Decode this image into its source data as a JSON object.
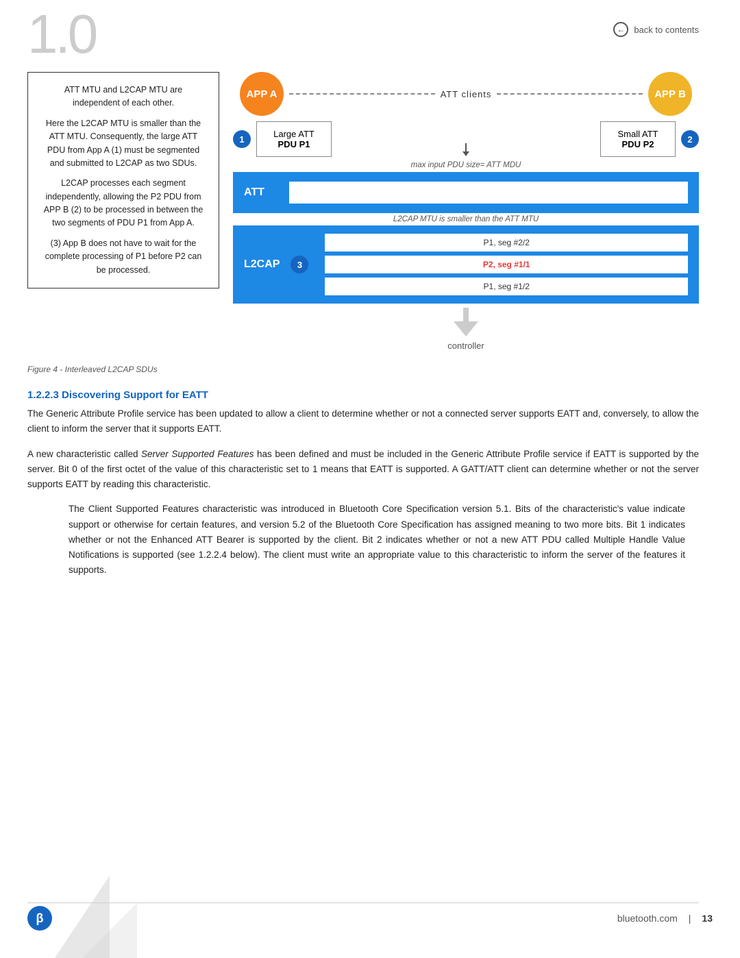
{
  "watermark": "1.0",
  "back_to_contents": "back to contents",
  "textbox": {
    "para1": "ATT MTU and L2CAP MTU are independent of each other.",
    "para2": "Here the L2CAP MTU is smaller than the ATT MTU. Consequently, the large ATT PDU from App A (1) must be segmented and submitted to L2CAP as two SDUs.",
    "para3": "L2CAP processes each segment independently, allowing the P2 PDU from APP B (2) to be processed in between the two segments of PDU P1 from App A.",
    "para4": "(3) App B does not have to wait for the complete processing of P1 before P2 can be processed."
  },
  "diagram": {
    "app_a_label": "APP A",
    "app_b_label": "APP B",
    "att_clients_label": "ATT clients",
    "badge1": "1",
    "badge2": "2",
    "badge3": "3",
    "pdu1_line1": "Large ATT",
    "pdu1_line2": "PDU P1",
    "pdu2_line1": "Small ATT",
    "pdu2_line2": "PDU P2",
    "max_input_label": "max input PDU size= ATT MDU",
    "att_label": "ATT",
    "l2cap_mtu_label": "L2CAP MTU is smaller than the ATT MTU",
    "l2cap_label": "L2CAP",
    "seg1": "P1, seg #2/2",
    "seg2": "P2, seg #1/1",
    "seg3": "P1, seg #1/2",
    "controller_label": "controller"
  },
  "figure_caption": "Figure 4 - Interleaved L2CAP SDUs",
  "section_heading": "1.2.2.3 Discovering Support for EATT",
  "paragraphs": [
    {
      "type": "normal",
      "text": "The Generic Attribute Profile service has been updated to allow a client to determine whether or not a connected server supports EATT and, conversely, to allow the client to inform the server that it supports EATT."
    },
    {
      "type": "normal",
      "text_parts": [
        {
          "text": "A new characteristic called ",
          "italic": false
        },
        {
          "text": "Server Supported Features",
          "italic": true
        },
        {
          "text": " has been defined and must be included in the Generic Attribute Profile service if EATT is supported by the server. Bit 0 of the first octet of the value of this characteristic set to 1 means that EATT is supported. A GATT/ATT client can determine whether or not the server supports EATT by reading this characteristic.",
          "italic": false
        }
      ]
    },
    {
      "type": "indent",
      "text": "The Client Supported Features characteristic was introduced in Bluetooth Core Specification version 5.1. Bits of the characteristic's value indicate support or otherwise for certain features, and version 5.2 of the Bluetooth Core Specification has assigned meaning to two more bits. Bit 1 indicates whether or not the Enhanced ATT Bearer is supported by the client. Bit 2 indicates whether or not a new ATT PDU called Multiple Handle Value Notifications is supported (see 1.2.2.4 below). The client must write an appropriate value to this characteristic to inform the server of the features it supports."
    }
  ],
  "footer": {
    "website": "bluetooth.com",
    "separator": "|",
    "page": "13"
  }
}
